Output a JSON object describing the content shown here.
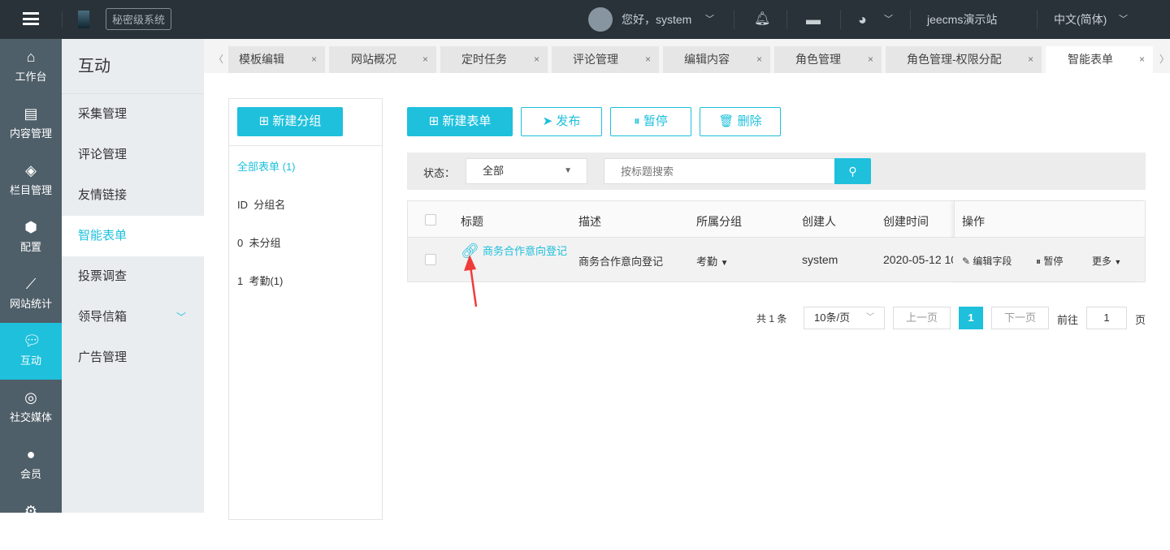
{
  "header": {
    "system_badge": "秘密级系统",
    "greeting": "您好，system",
    "site": "jeecms演示站",
    "language": "中文(简体)"
  },
  "nav": [
    {
      "label": "工作台",
      "icon": "home-icon"
    },
    {
      "label": "内容管理",
      "icon": "document-icon"
    },
    {
      "label": "栏目管理",
      "icon": "layers-icon"
    },
    {
      "label": "配置",
      "icon": "cube-icon"
    },
    {
      "label": "网站统计",
      "icon": "chart-icon"
    },
    {
      "label": "互动",
      "icon": "chat-icon"
    },
    {
      "label": "社交媒体",
      "icon": "social-icon"
    },
    {
      "label": "会员",
      "icon": "user-icon"
    }
  ],
  "sidebar": {
    "title": "互动",
    "items": [
      "采集管理",
      "评论管理",
      "友情链接",
      "智能表单",
      "投票调查",
      "领导信箱",
      "广告管理"
    ]
  },
  "tabs": [
    "模板编辑",
    "网站概况",
    "定时任务",
    "评论管理",
    "编辑内容",
    "角色管理",
    "角色管理-权限分配",
    "智能表单"
  ],
  "groups": {
    "new_button": "新建分组",
    "all": "全部表单 (1)",
    "header_id": "ID",
    "header_name": "分组名",
    "rows": [
      {
        "id": "0",
        "name": "未分组"
      },
      {
        "id": "1",
        "name": "考勤(1)"
      }
    ]
  },
  "toolbar": {
    "new": "新建表单",
    "publish": "发布",
    "pause": "暂停",
    "delete": "删除"
  },
  "filter": {
    "status_label": "状态：",
    "status_value": "全部",
    "search_placeholder": "按标题搜索"
  },
  "table": {
    "headers": [
      "标题",
      "描述",
      "所属分组",
      "创建人",
      "创建时间",
      "操作"
    ],
    "rows": [
      {
        "title": "商务合作意向登记",
        "desc": "商务合作意向登记",
        "group": "考勤",
        "creator": "system",
        "created": "2020-05-12 10",
        "edit": "编辑字段",
        "pause": "暂停",
        "more": "更多"
      }
    ]
  },
  "pagination": {
    "total": "共 1 条",
    "page_size": "10条/页",
    "prev": "上一页",
    "current": "1",
    "next": "下一页",
    "goto": "前往",
    "goto_value": "1",
    "page_unit": "页"
  },
  "colors": {
    "accent": "#1ec0dc",
    "topbar": "#283238"
  }
}
